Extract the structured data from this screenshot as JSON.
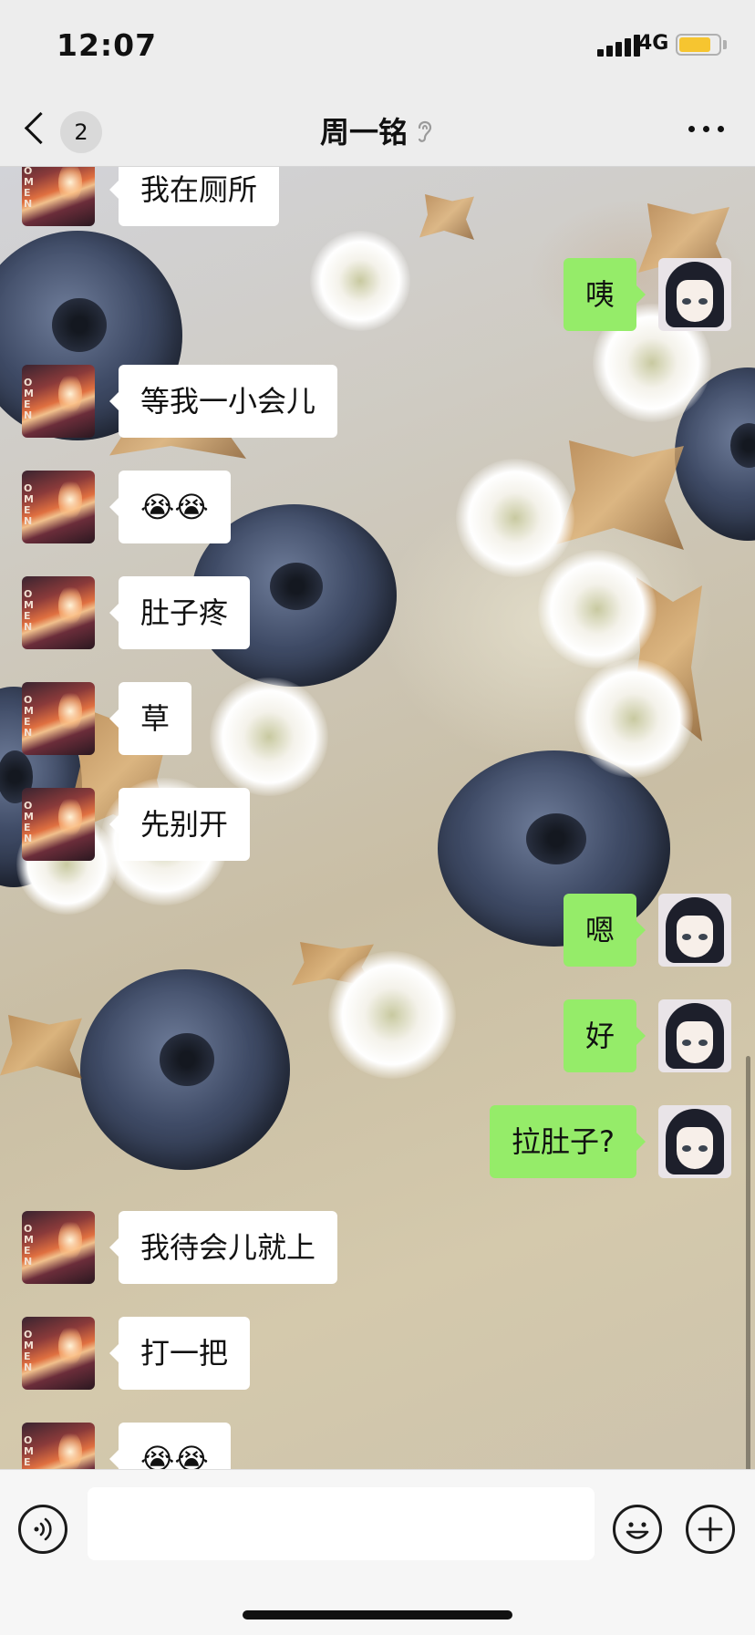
{
  "status_bar": {
    "time": "12:07",
    "network": "4G",
    "battery_level": 0.75,
    "battery_color": "#f6c530"
  },
  "nav": {
    "back_icon": "chevron-left-icon",
    "unread_count": "2",
    "title": "周一铭",
    "earpiece_mode_icon": "ear-icon",
    "more_icon": "more-dots-icon"
  },
  "messages": [
    {
      "side": "left",
      "text": "我在厕所"
    },
    {
      "side": "right",
      "text": "咦"
    },
    {
      "side": "left",
      "text": "等我一小会儿"
    },
    {
      "side": "left",
      "text": "😭😭"
    },
    {
      "side": "left",
      "text": "肚子疼"
    },
    {
      "side": "left",
      "text": "草"
    },
    {
      "side": "left",
      "text": "先别开"
    },
    {
      "side": "right",
      "text": "嗯"
    },
    {
      "side": "right",
      "text": "好"
    },
    {
      "side": "right",
      "text": "拉肚子?"
    },
    {
      "side": "left",
      "text": "我待会儿就上"
    },
    {
      "side": "left",
      "text": "打一把"
    },
    {
      "side": "left",
      "text": "😭😭"
    }
  ],
  "input_bar": {
    "voice_icon": "voice-icon",
    "input_value": "",
    "emoji_icon": "emoji-icon",
    "add_icon": "plus-icon"
  },
  "colors": {
    "outgoing_bubble": "#95ec69",
    "incoming_bubble": "#ffffff",
    "bar_background": "#ededed"
  }
}
